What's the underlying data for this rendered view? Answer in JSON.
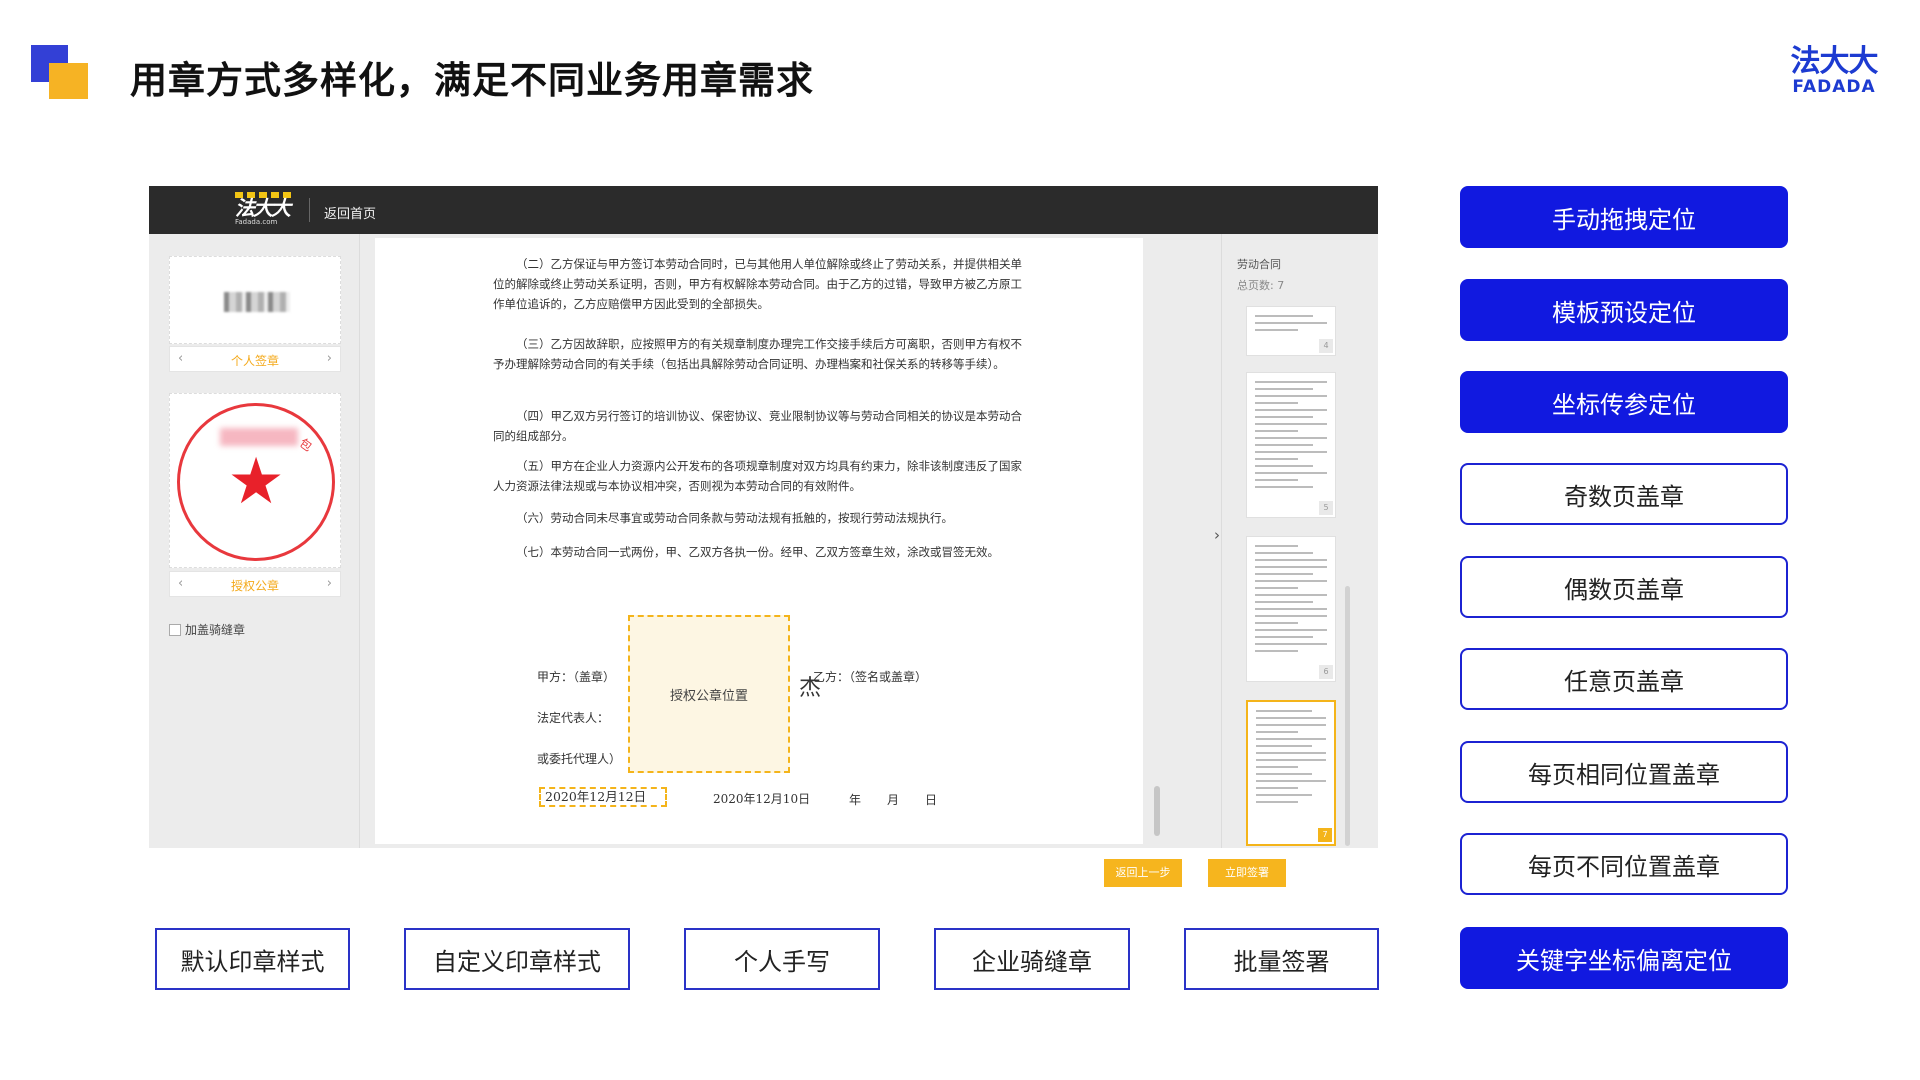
{
  "slide": {
    "title": "用章方式多样化，满足不同业务用章需求",
    "brand_cn": "法大大",
    "brand_en": "FADADA"
  },
  "app": {
    "logo_text": "法大大",
    "logo_url": "Fadada.com",
    "back_home": "返回首页",
    "left_panel": {
      "personal_sign_label": "个人签章",
      "authorized_seal_label": "授权公章",
      "stamp_text_tail": "包",
      "cross_page_checkbox": "加盖骑缝章",
      "prev_arrow": "‹",
      "next_arrow": "›"
    },
    "document": {
      "paragraphs": [
        "（二）乙方保证与甲方签订本劳动合同时，已与其他用人单位解除或终止了劳动关系，并提供相关单位的解除或终止劳动关系证明，否则，甲方有权解除本劳动合同。由于乙方的过错，导致甲方被乙方原工作单位追诉的，乙方应赔偿甲方因此受到的全部损失。",
        "（三）乙方因故辞职，应按照甲方的有关规章制度办理完工作交接手续后方可离职，否则甲方有权不予办理解除劳动合同的有关手续（包括出具解除劳动合同证明、办理档案和社保关系的转移等手续）。",
        "（四）甲乙双方另行签订的培训协议、保密协议、竞业限制协议等与劳动合同相关的协议是本劳动合同的组成部分。",
        "（五）甲方在企业人力资源内公开发布的各项规章制度对双方均具有约束力，除非该制度违反了国家人力资源法律法规或与本协议相冲突，否则视为本劳动合同的有效附件。",
        "（六）劳动合同未尽事宜或劳动合同条款与劳动法规有抵触的，按现行劳动法规执行。",
        "（七）本劳动合同一式两份，甲、乙双方各执一份。经甲、乙双方签章生效，涂改或冒签无效。"
      ],
      "party_a": "甲方：（盖章）",
      "party_b": "乙方：（签名或盖章）",
      "legal_rep": "法定代表人：",
      "agent": "或委托代理人）",
      "stamp_placeholder": "授权公章位置",
      "signature_char": "杰",
      "date_a": "2020年12月12日",
      "date_b": "2020年12月10日",
      "date_blank_year": "年",
      "date_blank_month": "月",
      "date_blank_day": "日"
    },
    "pages_panel": {
      "title": "劳动合同",
      "total_label": "总页数:",
      "total": "7",
      "collapse_arrow": "›",
      "thumbnails": [
        {
          "page": "4",
          "active": false
        },
        {
          "page": "5",
          "active": false
        },
        {
          "page": "6",
          "active": false
        },
        {
          "page": "7",
          "active": true
        }
      ]
    },
    "buttons": {
      "prev_step": "返回上一步",
      "sign_now": "立即签署"
    },
    "colors": {
      "accent": "#f6b51e",
      "topbar": "#2b2b2b"
    }
  },
  "features": [
    "默认印章样式",
    "自定义印章样式",
    "个人手写",
    "企业骑缝章",
    "批量签署"
  ],
  "options": [
    {
      "label": "手动拖拽定位",
      "style": "filled"
    },
    {
      "label": "模板预设定位",
      "style": "filled"
    },
    {
      "label": "坐标传参定位",
      "style": "filled"
    },
    {
      "label": "奇数页盖章",
      "style": "outline"
    },
    {
      "label": "偶数页盖章",
      "style": "outline"
    },
    {
      "label": "任意页盖章",
      "style": "outline"
    },
    {
      "label": "每页相同位置盖章",
      "style": "outline"
    },
    {
      "label": "每页不同位置盖章",
      "style": "outline"
    },
    {
      "label": "关键字坐标偏离定位",
      "style": "filled"
    }
  ],
  "theme": {
    "primary_blue": "#1119e0",
    "deco_orange": "#f6b324"
  }
}
